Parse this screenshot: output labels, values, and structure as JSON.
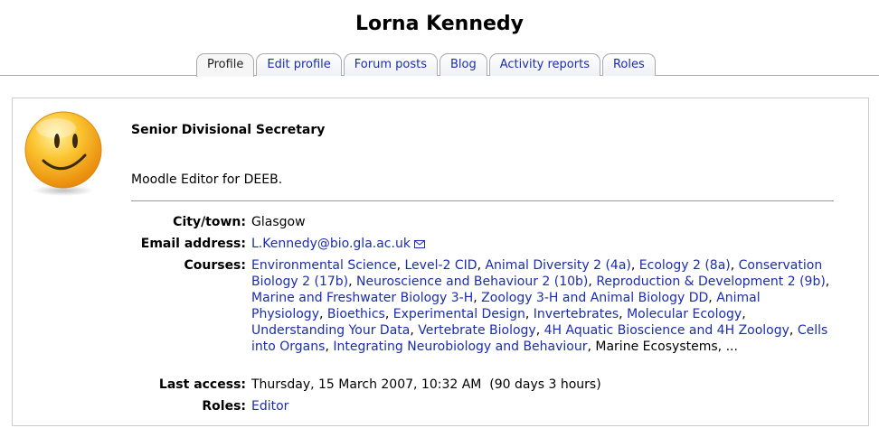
{
  "page": {
    "title": "Lorna Kennedy"
  },
  "tabs": [
    {
      "label": "Profile",
      "selected": true
    },
    {
      "label": "Edit profile",
      "selected": false
    },
    {
      "label": "Forum posts",
      "selected": false
    },
    {
      "label": "Blog",
      "selected": false
    },
    {
      "label": "Activity reports",
      "selected": false
    },
    {
      "label": "Roles",
      "selected": false
    }
  ],
  "profile": {
    "avatar_icon": "smiley-face-icon",
    "position": "Senior Divisional Secretary",
    "description": "Moodle Editor for DEEB.",
    "fields": {
      "city": {
        "label": "City/town:",
        "value": "Glasgow"
      },
      "email": {
        "label": "Email address:",
        "value": "L.Kennedy@bio.gla.ac.uk",
        "icon": "envelope-icon"
      },
      "courses": {
        "label": "Courses:"
      },
      "last_access": {
        "label": "Last access:",
        "value": "Thursday, 15 March 2007, 10:32 AM  (90 days 3 hours)"
      },
      "roles": {
        "label": "Roles:",
        "value": "Editor"
      }
    },
    "courses": [
      {
        "name": "Environmental Science",
        "link": true
      },
      {
        "name": "Level-2 CID",
        "link": true
      },
      {
        "name": "Animal Diversity 2 (4a)",
        "link": true
      },
      {
        "name": "Ecology 2 (8a)",
        "link": true
      },
      {
        "name": "Conservation Biology 2 (17b)",
        "link": true
      },
      {
        "name": "Neuroscience and Behaviour 2 (10b)",
        "link": true
      },
      {
        "name": "Reproduction & Development 2 (9b)",
        "link": true
      },
      {
        "name": "Marine and Freshwater Biology 3-H",
        "link": true
      },
      {
        "name": "Zoology 3-H and Animal Biology DD",
        "link": true
      },
      {
        "name": "Animal Physiology",
        "link": true
      },
      {
        "name": "Bioethics",
        "link": true
      },
      {
        "name": "Experimental Design",
        "link": true
      },
      {
        "name": "Invertebrates",
        "link": true
      },
      {
        "name": "Molecular Ecology",
        "link": true
      },
      {
        "name": "Understanding Your Data",
        "link": true
      },
      {
        "name": "Vertebrate Biology",
        "link": true
      },
      {
        "name": "4H Aquatic Bioscience and 4H Zoology",
        "link": true
      },
      {
        "name": "Cells into Organs",
        "link": true
      },
      {
        "name": "Integrating Neurobiology and Behaviour",
        "link": true
      },
      {
        "name": "Marine Ecosystems",
        "link": false
      }
    ],
    "courses_more": "..."
  },
  "colors": {
    "link": "#1a2dad",
    "avatar_yellow": "#f7b21c"
  }
}
